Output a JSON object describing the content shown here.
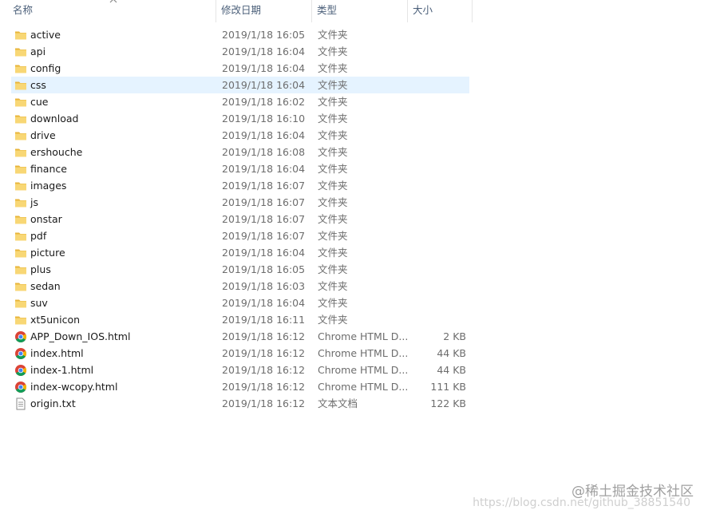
{
  "columns": {
    "name": "名称",
    "date": "修改日期",
    "type": "类型",
    "size": "大小"
  },
  "colors": {
    "folder": "#f8d775",
    "folder_dark": "#e8b53a",
    "selected_row": "#e5f3ff",
    "header_text": "#4c607a"
  },
  "rows": [
    {
      "name": "active",
      "date": "2019/1/18 16:05",
      "type": "文件夹",
      "size": "",
      "icon": "folder-icon"
    },
    {
      "name": "api",
      "date": "2019/1/18 16:04",
      "type": "文件夹",
      "size": "",
      "icon": "folder-icon"
    },
    {
      "name": "config",
      "date": "2019/1/18 16:04",
      "type": "文件夹",
      "size": "",
      "icon": "folder-icon"
    },
    {
      "name": "css",
      "date": "2019/1/18 16:04",
      "type": "文件夹",
      "size": "",
      "icon": "folder-icon",
      "selected": true
    },
    {
      "name": "cue",
      "date": "2019/1/18 16:02",
      "type": "文件夹",
      "size": "",
      "icon": "folder-icon"
    },
    {
      "name": "download",
      "date": "2019/1/18 16:10",
      "type": "文件夹",
      "size": "",
      "icon": "folder-icon"
    },
    {
      "name": "drive",
      "date": "2019/1/18 16:04",
      "type": "文件夹",
      "size": "",
      "icon": "folder-icon"
    },
    {
      "name": "ershouche",
      "date": "2019/1/18 16:08",
      "type": "文件夹",
      "size": "",
      "icon": "folder-icon"
    },
    {
      "name": "finance",
      "date": "2019/1/18 16:04",
      "type": "文件夹",
      "size": "",
      "icon": "folder-icon"
    },
    {
      "name": "images",
      "date": "2019/1/18 16:07",
      "type": "文件夹",
      "size": "",
      "icon": "folder-icon"
    },
    {
      "name": "js",
      "date": "2019/1/18 16:07",
      "type": "文件夹",
      "size": "",
      "icon": "folder-icon"
    },
    {
      "name": "onstar",
      "date": "2019/1/18 16:07",
      "type": "文件夹",
      "size": "",
      "icon": "folder-icon"
    },
    {
      "name": "pdf",
      "date": "2019/1/18 16:07",
      "type": "文件夹",
      "size": "",
      "icon": "folder-icon"
    },
    {
      "name": "picture",
      "date": "2019/1/18 16:04",
      "type": "文件夹",
      "size": "",
      "icon": "folder-icon"
    },
    {
      "name": "plus",
      "date": "2019/1/18 16:05",
      "type": "文件夹",
      "size": "",
      "icon": "folder-icon"
    },
    {
      "name": "sedan",
      "date": "2019/1/18 16:03",
      "type": "文件夹",
      "size": "",
      "icon": "folder-icon"
    },
    {
      "name": "suv",
      "date": "2019/1/18 16:04",
      "type": "文件夹",
      "size": "",
      "icon": "folder-icon"
    },
    {
      "name": "xt5unicon",
      "date": "2019/1/18 16:11",
      "type": "文件夹",
      "size": "",
      "icon": "folder-icon"
    },
    {
      "name": "APP_Down_IOS.html",
      "date": "2019/1/18 16:12",
      "type": "Chrome HTML D...",
      "size": "2 KB",
      "icon": "chrome-icon"
    },
    {
      "name": "index.html",
      "date": "2019/1/18 16:12",
      "type": "Chrome HTML D...",
      "size": "44 KB",
      "icon": "chrome-icon"
    },
    {
      "name": "index-1.html",
      "date": "2019/1/18 16:12",
      "type": "Chrome HTML D...",
      "size": "44 KB",
      "icon": "chrome-icon"
    },
    {
      "name": "index-wcopy.html",
      "date": "2019/1/18 16:12",
      "type": "Chrome HTML D...",
      "size": "111 KB",
      "icon": "chrome-icon"
    },
    {
      "name": "origin.txt",
      "date": "2019/1/18 16:12",
      "type": "文本文档",
      "size": "122 KB",
      "icon": "text-file-icon"
    }
  ],
  "watermark": {
    "main": "@稀土掘金技术社区",
    "url": "https://blog.csdn.net/github_38851540"
  }
}
